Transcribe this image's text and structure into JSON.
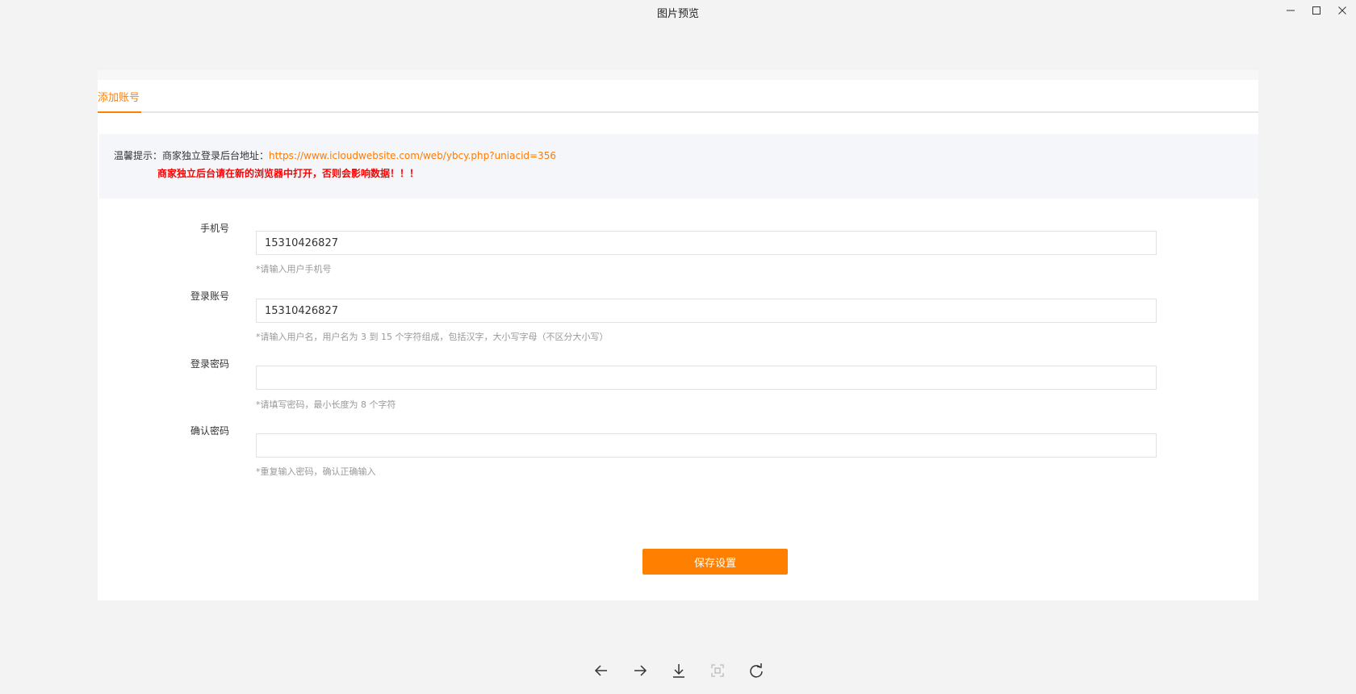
{
  "window": {
    "title": "图片预览",
    "controls": [
      "minimize-icon",
      "maximize-icon",
      "close-icon"
    ]
  },
  "tabs": [
    {
      "label": "添加账号",
      "active": true
    }
  ],
  "notice": {
    "prefix": "温馨提示：商家独立登录后台地址：",
    "url": "https://www.icloudwebsite.com/web/ybcy.php?uniacid=356",
    "warning": "商家独立后台请在新的浏览器中打开，否则会影响数据！！！"
  },
  "form": {
    "phone": {
      "label": "手机号",
      "value": "15310426827",
      "hint": "*请输入用户手机号"
    },
    "account": {
      "label": "登录账号",
      "value": "15310426827",
      "hint": "*请输入用户名，用户名为 3 到 15 个字符组成，包括汉字，大小写字母（不区分大小写）"
    },
    "password": {
      "label": "登录密码",
      "value": "",
      "hint": "*请填写密码，最小长度为 8 个字符"
    },
    "confirm": {
      "label": "确认密码",
      "value": "",
      "hint": "*重复输入密码，确认正确输入"
    },
    "save_label": "保存设置"
  },
  "toolbar": {
    "icons": [
      "arrow-left-icon",
      "arrow-right-icon",
      "download-icon",
      "fit-screen-icon",
      "rotate-icon"
    ]
  },
  "colors": {
    "accent": "#ff8000",
    "warning": "#ff0000",
    "hint": "#999999",
    "background": "#f3f3f3"
  }
}
